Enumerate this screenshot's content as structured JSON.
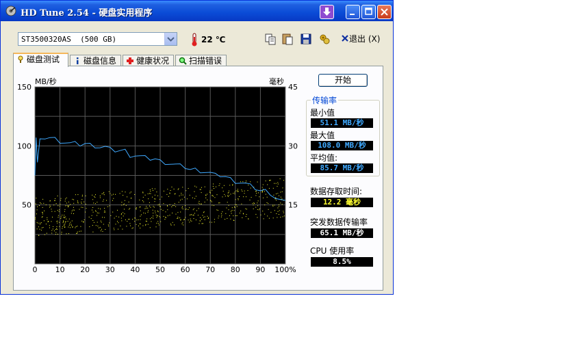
{
  "window": {
    "title": "HD Tune 2.54 - 硬盘实用程序"
  },
  "toolbar": {
    "drive": "ST3500320AS  (500 GB)",
    "temperature": "22 ℃",
    "exit_label": "退出 (X)"
  },
  "tabs": [
    {
      "label": "磁盘测试",
      "icon": "benchmark-icon"
    },
    {
      "label": "磁盘信息",
      "icon": "info-icon"
    },
    {
      "label": "健康状况",
      "icon": "health-cross-icon"
    },
    {
      "label": "扫描错误",
      "icon": "magnifier-icon"
    }
  ],
  "start_button": "开始",
  "results": {
    "transfer_group": "传输率",
    "min_label": "最小值",
    "min_value": "51.1 MB/秒",
    "max_label": "最大值",
    "max_value": "108.0 MB/秒",
    "avg_label": "平均值:",
    "avg_value": "85.7 MB/秒",
    "access_label": "数据存取时间:",
    "access_value": "12.2 毫秒",
    "burst_label": "突发数据传输率",
    "burst_value": "65.1 MB/秒",
    "cpu_label": "CPU 使用率",
    "cpu_value": "8.5%"
  },
  "colors": {
    "transfer_line": "#3FA9FF",
    "access_points": "#FFFF30",
    "title_bar": "#0A4BD6"
  },
  "chart_data": {
    "type": "line",
    "ylabel_left": "MB/秒",
    "ylabel_right": "毫秒",
    "xlim": [
      0,
      100
    ],
    "ylim_left": [
      0,
      150
    ],
    "ylim_right": [
      0,
      45
    ],
    "x_ticks": [
      "0",
      "10",
      "20",
      "30",
      "40",
      "50",
      "60",
      "70",
      "80",
      "90",
      "100%"
    ],
    "y_ticks_left": [
      "150",
      "100",
      "50"
    ],
    "y_ticks_right": [
      "45",
      "30",
      "15"
    ],
    "grid": true,
    "series": [
      {
        "kind": "transfer_rate",
        "x": [
          0,
          0.5,
          1,
          2,
          4,
          6,
          8,
          10,
          12,
          14,
          16,
          18,
          20,
          22,
          24,
          26,
          28,
          30,
          32,
          34,
          36,
          38,
          40,
          42,
          44,
          46,
          48,
          50,
          52,
          54,
          56,
          58,
          60,
          62,
          64,
          66,
          68,
          70,
          72,
          74,
          76,
          78,
          80,
          82,
          84,
          86,
          88,
          90,
          92,
          94,
          96,
          98,
          100
        ],
        "y": [
          75,
          107,
          86,
          106,
          107,
          107,
          106,
          104,
          103,
          102,
          102,
          101,
          102,
          101,
          100,
          99,
          99,
          97,
          96,
          96,
          96,
          92,
          92,
          91,
          90,
          89,
          89,
          87,
          86,
          85,
          84,
          83,
          82,
          80,
          80,
          79,
          78,
          77,
          75,
          75,
          74,
          72,
          70,
          69,
          68,
          66,
          64,
          62,
          62,
          60,
          56,
          54,
          52
        ]
      },
      {
        "kind": "access_time",
        "approx_range_ms": [
          5,
          25
        ]
      }
    ]
  }
}
